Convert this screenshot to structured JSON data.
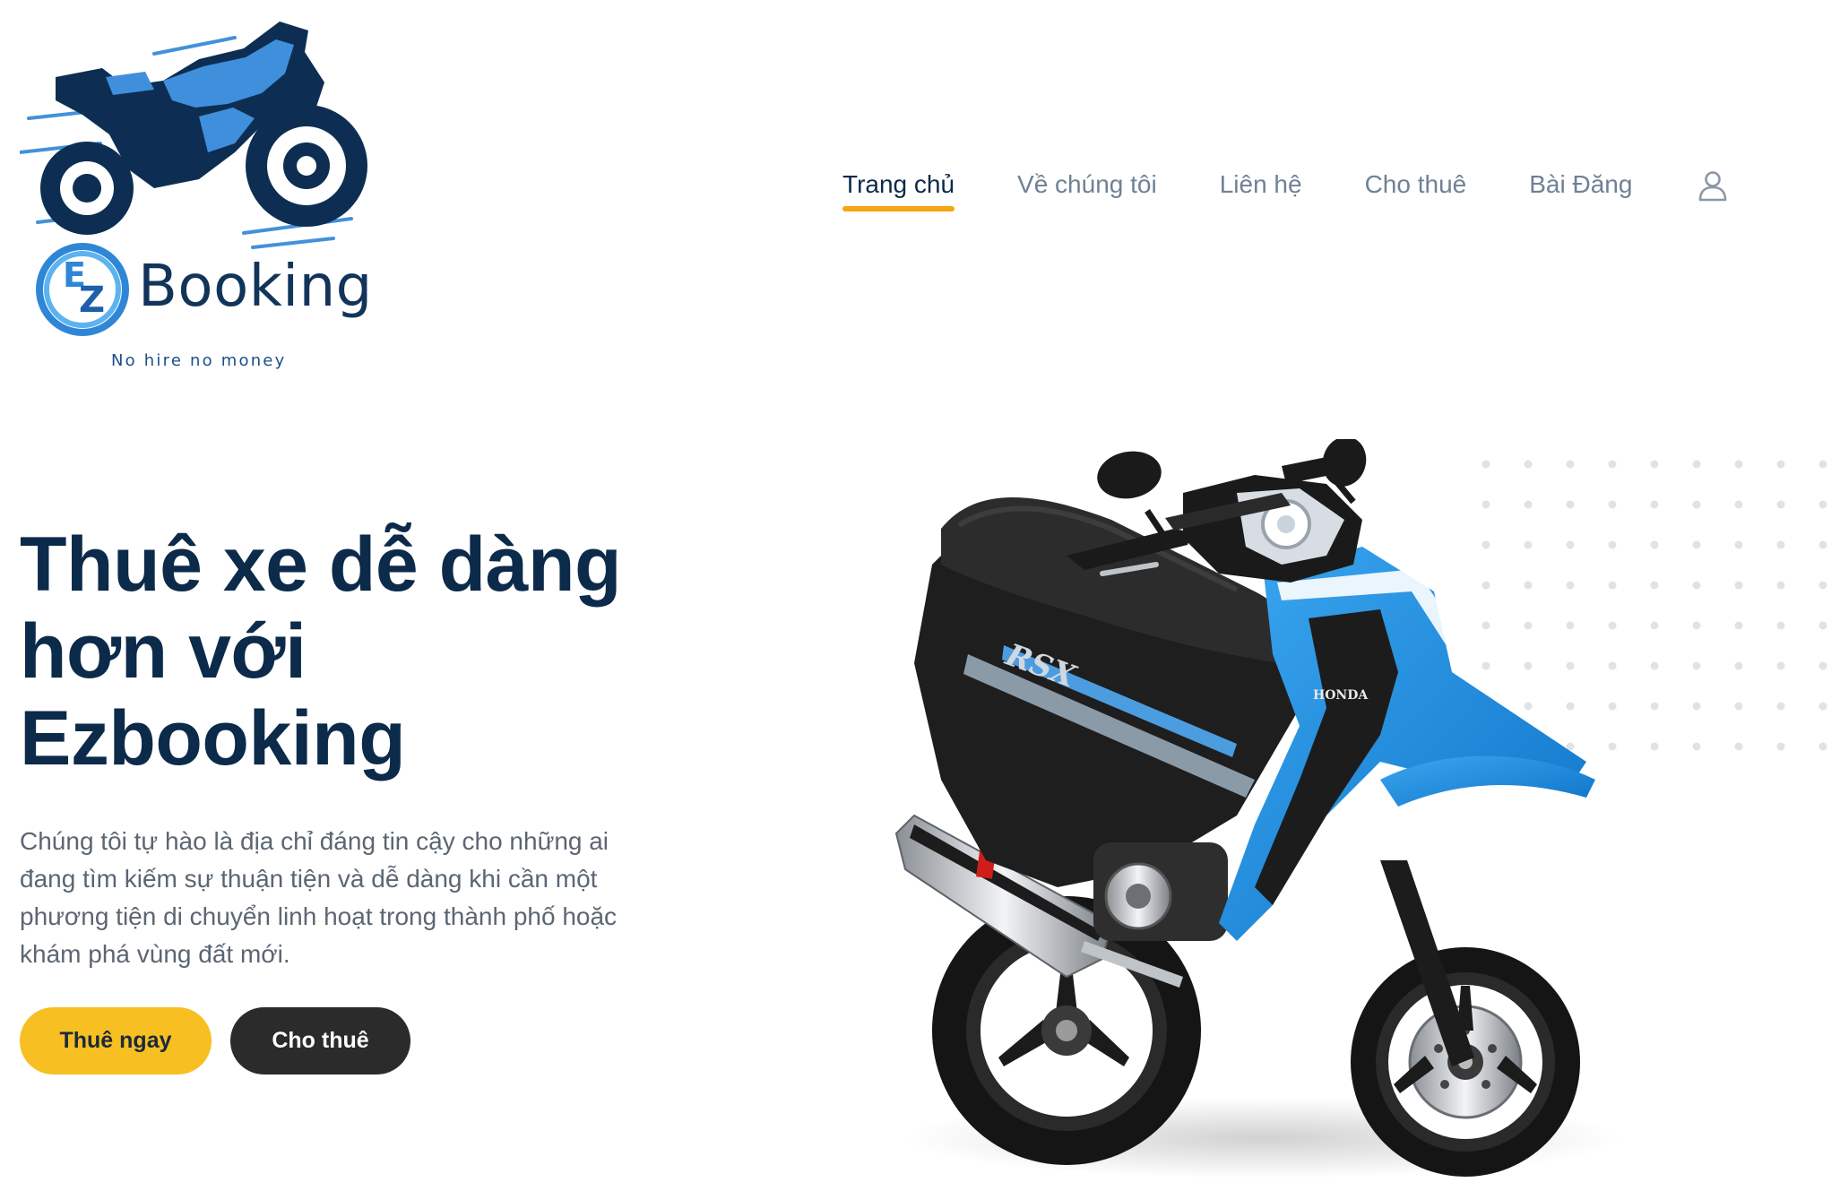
{
  "logo": {
    "brand_letters": "EZ",
    "wordmark": "Booking",
    "tagline": "No hire no money"
  },
  "nav": {
    "items": [
      {
        "label": "Trang chủ",
        "active": true
      },
      {
        "label": "Về chúng tôi",
        "active": false
      },
      {
        "label": "Liên hệ",
        "active": false
      },
      {
        "label": "Cho thuê",
        "active": false
      },
      {
        "label": "Bài Đăng",
        "active": false
      }
    ],
    "user_icon": "user-icon",
    "active_underline_color": "#f6a514"
  },
  "hero": {
    "title_lines": [
      "Thuê xe dễ dàng",
      "hơn với",
      "Ezbooking"
    ],
    "description": "Chúng tôi tự hào là địa chỉ đáng tin cậy cho những ai đang tìm kiếm sự thuận tiện và dễ dàng khi cần một phương tiện di chuyển linh hoạt trong thành phố hoặc khám phá vùng đất mới.",
    "primary_button": "Thuê ngay",
    "secondary_button": "Cho thuê"
  },
  "scooter_image": {
    "brand_text": "HONDA",
    "model_text": "RSX"
  },
  "colors": {
    "primary_button": "#f8bf22",
    "secondary_button": "#2b2b2b",
    "heading": "#0c2a4a",
    "accent_blue": "#1e88d8"
  }
}
